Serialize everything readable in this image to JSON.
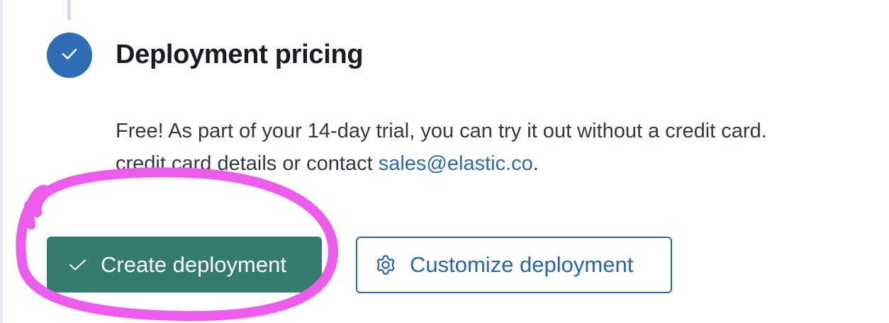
{
  "step": {
    "title": "Deployment pricing",
    "status_icon": "checkmark-icon",
    "status_color": "#2f6db5"
  },
  "description": {
    "line1": "Free! As part of your 14-day trial, you can try it out without a credit card.",
    "line2_prefix": "credit card details or contact ",
    "link_text": "sales@elastic.co",
    "line2_suffix": "."
  },
  "buttons": {
    "create": {
      "label": "Create deployment",
      "icon": "checkmark-icon",
      "color": "#357b70"
    },
    "customize": {
      "label": "Customize deployment",
      "icon": "gear-icon",
      "color": "#2d67a8"
    }
  },
  "annotation": {
    "type": "hand-drawn circle",
    "color": "#ee5cee"
  }
}
